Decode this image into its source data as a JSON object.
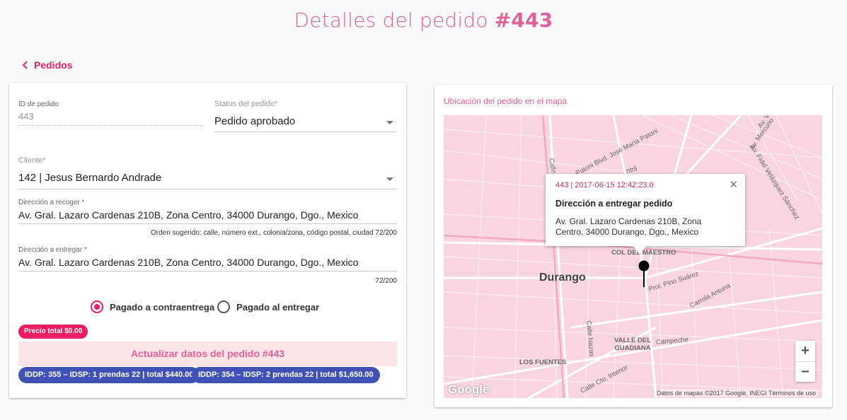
{
  "header": {
    "title_prefix": "Detalles del pedido ",
    "title_number": "#443"
  },
  "nav": {
    "back_label": "Pedidos"
  },
  "form": {
    "order_id_label": "ID de pedido",
    "order_id_value": "443",
    "status_label": "Status del pedido*",
    "status_value": "Pedido aprobado",
    "client_label": "Cliente*",
    "client_value": "142 | Jesus Bernardo Andrade",
    "pickup_label": "Dirección a recoger *",
    "pickup_value": "Av. Gral. Lazaro Cardenas 210B, Zona Centro, 34000 Durango, Dgo., Mexico",
    "pickup_hint": "Orden sugerido: calle, número ext., colonia/zona, código postal, ciudad 72/200",
    "delivery_label": "Dirección a entregar *",
    "delivery_value": "Av. Gral. Lazaro Cardenas 210B, Zona Centro, 34000 Durango, Dgo., Mexico",
    "delivery_counter": "72/200",
    "payment_options": [
      {
        "label": "Pagado a contraentrega",
        "checked": true
      },
      {
        "label": "Pagado al entregar",
        "checked": false
      }
    ],
    "total_chip": "Precio total $0.00",
    "update_button": "Actualizar datos del pedido #443",
    "records": [
      "IDDP: 355 – IDSP: 1 prendas 22 | total $440.00",
      "IDDP: 354 – IDSP: 2 prendas 22 | total $1,650.00"
    ]
  },
  "map": {
    "title": "Ubicación del pedido en el mapa",
    "info_header": "443 | 2017-06-15 12:42:23.0",
    "info_title": "Dirección a entregar pedido",
    "info_address": "Av. Gral. Lazaro Cardenas 210B, Zona Centro, 34000 Durango, Dgo., Mexico",
    "city_label": "Durango",
    "labels": {
      "col_del_maestro": "COL DEL MAESTRO",
      "valle_del_guadiana": "VALLE DEL GUADIANA",
      "los_fuentes": "LOS FUENTES",
      "calle_nazas": "Calle Nazas",
      "campeche": "Campeche",
      "carrola_antuna": "Carrola Antuna",
      "prol_pino_suarez": "Prol. Pino Suárez",
      "calle_cto_interior": "Calle Cto. Interior",
      "av_fidel": "Av. Fidel Velázquez Sánchez",
      "av_mercurio": "Av. Mercurio",
      "blvd_jose_maria_patoni": "Patoni Blvd. José María Patoni",
      "av_vid": "Av. Vid",
      "calle": "Calle",
      "ntril": "ntril"
    },
    "zoom_in": "+",
    "zoom_out": "−",
    "google_logo": "Google",
    "attribution": "Datos de mapas ©2017 Google, INEGI   Términos de uso",
    "colors": {
      "accent": "#e91e63",
      "map_bg": "#f8d5e0",
      "chip_blue": "#3f51b5"
    }
  }
}
